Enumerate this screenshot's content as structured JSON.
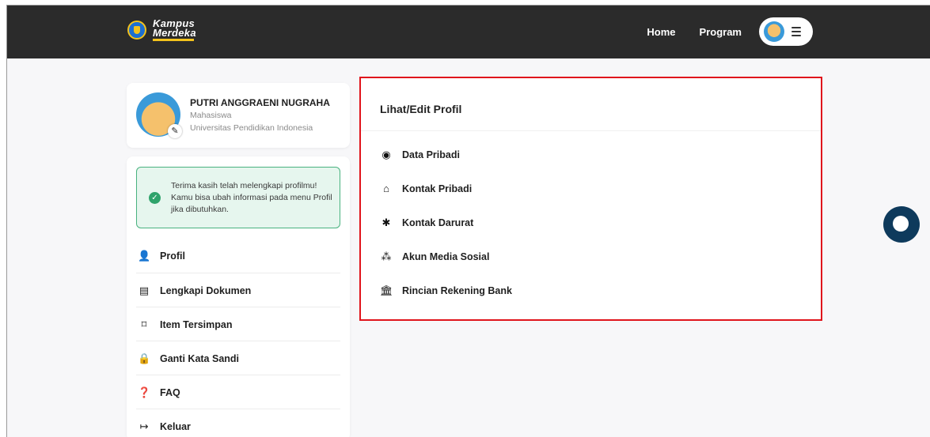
{
  "brand": {
    "line1": "Kampus",
    "line2": "Merdeka"
  },
  "nav": {
    "links": [
      "Home",
      "Program"
    ]
  },
  "profile": {
    "name": "PUTRI ANGGRAENI NUGRAHA",
    "role": "Mahasiswa",
    "university": "Universitas Pendidikan Indonesia"
  },
  "notice": {
    "text": "Terima kasih telah melengkapi profilmu! Kamu bisa ubah informasi pada menu Profil jika dibutuhkan."
  },
  "side_menu": [
    {
      "icon": "user-gear-icon",
      "label": "Profil"
    },
    {
      "icon": "document-alert-icon",
      "label": "Lengkapi Dokumen"
    },
    {
      "icon": "bookmark-icon",
      "label": "Item Tersimpan"
    },
    {
      "icon": "lock-icon",
      "label": "Ganti Kata Sandi"
    },
    {
      "icon": "question-icon",
      "label": "FAQ"
    },
    {
      "icon": "logout-icon",
      "label": "Keluar"
    }
  ],
  "panel": {
    "title": "Lihat/Edit Profil",
    "items": [
      {
        "icon": "user-circle-icon",
        "label": "Data Pribadi"
      },
      {
        "icon": "home-icon",
        "label": "Kontak Pribadi"
      },
      {
        "icon": "asterisk-icon",
        "label": "Kontak Darurat"
      },
      {
        "icon": "users-icon",
        "label": "Akun Media Sosial"
      },
      {
        "icon": "bank-icon",
        "label": "Rincian Rekening Bank"
      }
    ]
  },
  "colors": {
    "navbar": "#2b2b2b",
    "highlight_border": "#e0141c",
    "success_border": "#49b27f",
    "chat_button": "#0e3a5c"
  }
}
